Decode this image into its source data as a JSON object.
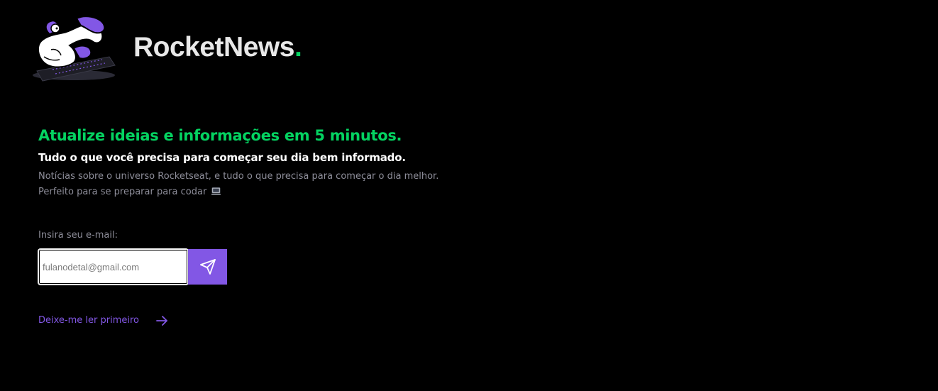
{
  "header": {
    "brand_name": "RocketNews",
    "brand_dot": ".",
    "logo_icon": "astronaut-with-laptop-illustration"
  },
  "hero": {
    "headline": "Atualize ideias e informações em 5 minutos.",
    "subheadline": "Tudo o que você precisa para começar seu dia bem informado.",
    "description_line_1": "Notícias sobre o universo Rocketseat, e tudo o que precisa para começar o dia melhor.",
    "description_line_2": "Perfeito para se preparar para codar",
    "description_emoji": "laptop-emoji"
  },
  "subscribe": {
    "label": "Insira seu e-mail:",
    "input_placeholder": "fulanodetal@gmail.com",
    "input_value": "",
    "submit_icon": "send-icon"
  },
  "link": {
    "label": "Deixe-me ler primeiro",
    "icon": "arrow-right-icon"
  },
  "colors": {
    "background": "#000000",
    "accent_green": "#04d361",
    "accent_purple": "#8257e5",
    "text_muted": "#8d8d99",
    "text_light": "#e8e8e8"
  }
}
